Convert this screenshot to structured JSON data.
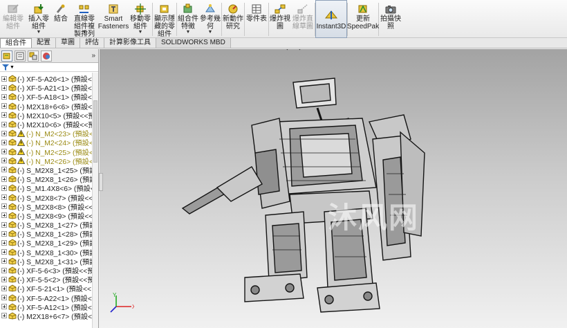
{
  "ribbon": {
    "buttons": [
      {
        "label": "編輯零\n組件",
        "icon": "edit-component-icon",
        "disabled": true
      },
      {
        "label": "插入零\n組件",
        "icon": "insert-component-icon",
        "dropdown": true
      },
      {
        "label": "結合",
        "icon": "mate-icon"
      },
      {
        "label": "直線零\n組件複\n製排列",
        "icon": "linear-pattern-icon",
        "dropdown": true
      },
      {
        "label": "Smart\nFasteners",
        "icon": "smart-fasteners-icon"
      },
      {
        "label": "移動零\n組件",
        "icon": "move-component-icon",
        "dropdown": true
      },
      {
        "label": "顯示隱\n藏的零\n組件",
        "icon": "show-hidden-icon"
      },
      {
        "label": "組合件\n特徵",
        "icon": "assembly-feature-icon",
        "dropdown": true
      },
      {
        "label": "參考幾\n何",
        "icon": "reference-geometry-icon",
        "dropdown": true
      },
      {
        "label": "新動作\n研究",
        "icon": "motion-study-icon"
      },
      {
        "label": "零件表",
        "icon": "bom-icon"
      },
      {
        "label": "爆炸視\n圖",
        "icon": "exploded-view-icon"
      },
      {
        "label": "爆炸直\n線草圖",
        "icon": "explode-line-sketch-icon",
        "disabled": true
      },
      {
        "label": "Instant3D",
        "icon": "instant3d-icon",
        "active": true
      },
      {
        "label": "更新\nSpeedPak",
        "icon": "speedpak-icon"
      },
      {
        "label": "拍攝快\n照",
        "icon": "snapshot-icon"
      }
    ]
  },
  "tabs": [
    "組合件",
    "配置",
    "草圖",
    "評估",
    "計算影像工具",
    "SOLIDWORKS MBD"
  ],
  "active_tab": "組合件",
  "tree": {
    "items": [
      {
        "name": "(-) XF-5-A26<1> (預設<<",
        "warn": false
      },
      {
        "name": "(-) XF-5-A21<1> (預設<<",
        "warn": false
      },
      {
        "name": "(-) XF-5-A18<1> (預設<<",
        "warn": false
      },
      {
        "name": "(-) M2X18+6<6> (預設<",
        "warn": false
      },
      {
        "name": "(-) M2X10<5> (預設<<預",
        "warn": false
      },
      {
        "name": "(-) M2X10<6> (預設<<預",
        "warn": false
      },
      {
        "name": "(-) N_M2<23> (預設<<",
        "warn": true
      },
      {
        "name": "(-) N_M2<24> (預設<<",
        "warn": true
      },
      {
        "name": "(-) N_M2<25> (預設<<",
        "warn": true
      },
      {
        "name": "(-) N_M2<26> (預設<<",
        "warn": true
      },
      {
        "name": "(-) S_M2X8_1<25> (預設",
        "warn": false
      },
      {
        "name": "(-) S_M2X8_1<26> (預設",
        "warn": false
      },
      {
        "name": "(-) S_M1.4X8<6> (預設<",
        "warn": false
      },
      {
        "name": "(-) S_M2X8<7> (預設<<",
        "warn": false
      },
      {
        "name": "(-) S_M2X8<8> (預設<<",
        "warn": false
      },
      {
        "name": "(-) S_M2X8<9> (預設<<",
        "warn": false
      },
      {
        "name": "(-) S_M2X8_1<27> (預設",
        "warn": false
      },
      {
        "name": "(-) S_M2X8_1<28> (預設",
        "warn": false
      },
      {
        "name": "(-) S_M2X8_1<29> (預設",
        "warn": false
      },
      {
        "name": "(-) S_M2X8_1<30> (預設",
        "warn": false
      },
      {
        "name": "(-) S_M2X8_1<31> (預設",
        "warn": false
      },
      {
        "name": "(-) XF-5-6<3> (預設<<預",
        "warn": false
      },
      {
        "name": "(-) XF-5-5<2> (預設<<預",
        "warn": false
      },
      {
        "name": "(-) XF-5-21<1> (預設<<",
        "warn": false
      },
      {
        "name": "(-) XF-5-A22<1> (預設<<",
        "warn": false
      },
      {
        "name": "(-) XF-5-A12<1> (預設<<",
        "warn": false
      },
      {
        "name": "(-) M2X18+6<7> (預設<",
        "warn": false
      }
    ]
  },
  "watermark": "沐风网",
  "triad": {
    "x": "X",
    "y": "Y"
  }
}
